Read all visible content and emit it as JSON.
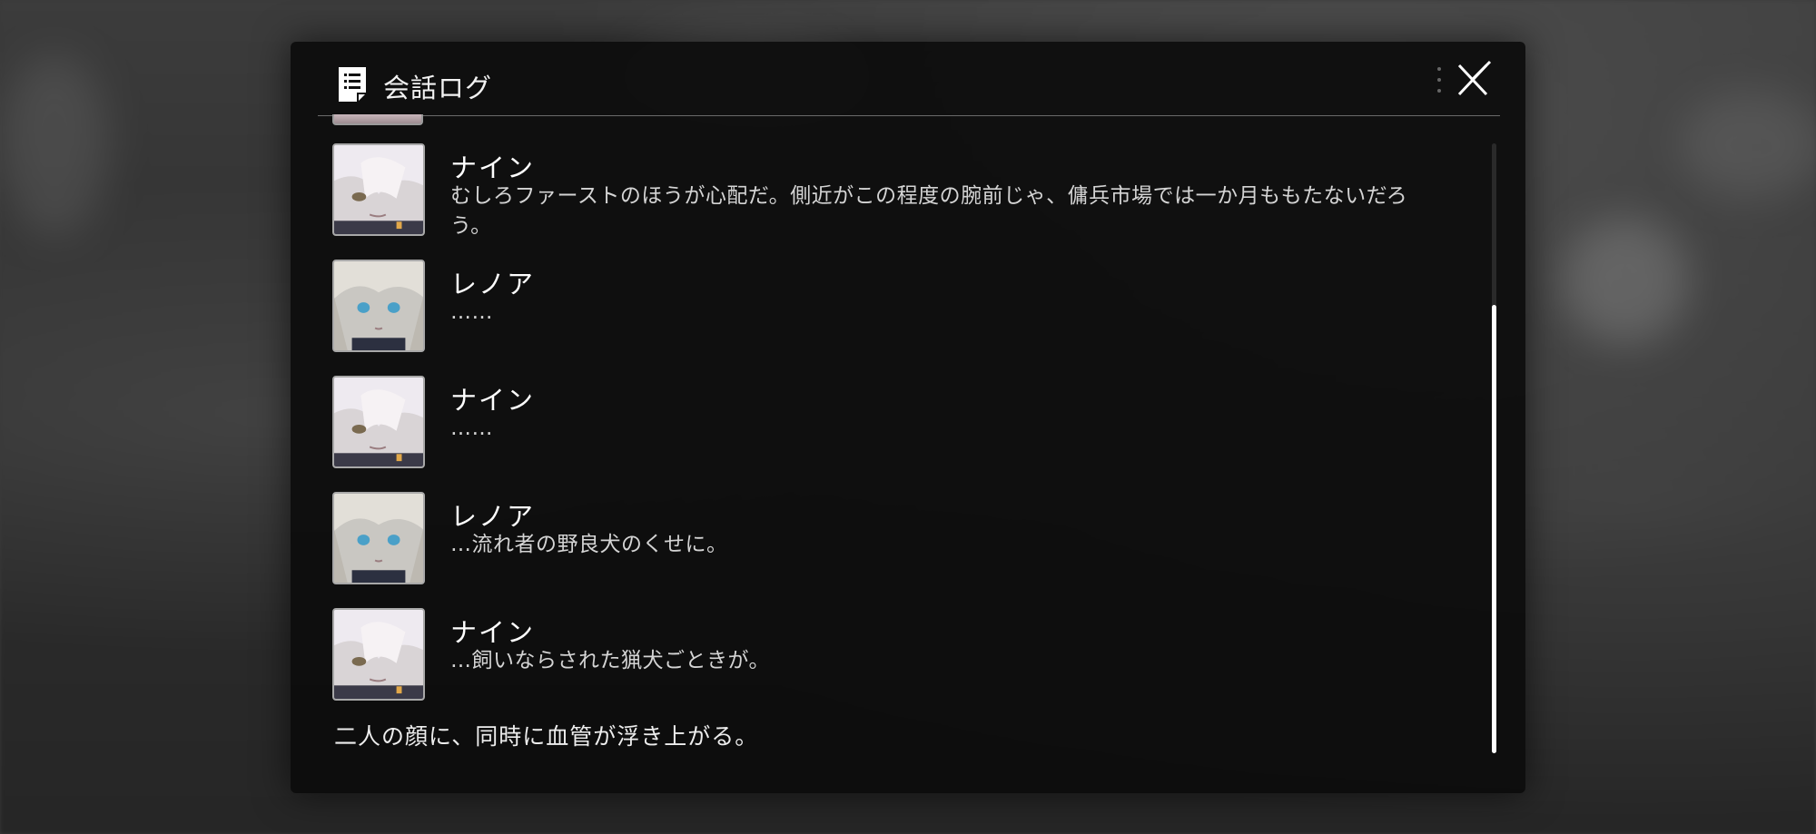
{
  "dialog": {
    "title": "会話ログ",
    "icons": {
      "log": "document-list-icon",
      "close": "close-x-icon",
      "handle": "drag-dots-icon"
    }
  },
  "entries": [
    {
      "speaker": "ナイン",
      "avatar": "portrait-nine",
      "text": "むしろファーストのほうが心配だ。側近がこの程度の腕前じゃ、傭兵市場では一か月ももたないだろう。"
    },
    {
      "speaker": "レノア",
      "avatar": "portrait-lenoa",
      "text": "……"
    },
    {
      "speaker": "ナイン",
      "avatar": "portrait-nine",
      "text": "……"
    },
    {
      "speaker": "レノア",
      "avatar": "portrait-lenoa",
      "text": "…流れ者の野良犬のくせに。"
    },
    {
      "speaker": "ナイン",
      "avatar": "portrait-nine",
      "text": "…飼いならされた猟犬ごときが。"
    }
  ],
  "narration": "二人の顔に、同時に血管が浮き上がる。",
  "scroll": {
    "thumb_fraction": 0.74,
    "position": "bottom"
  }
}
